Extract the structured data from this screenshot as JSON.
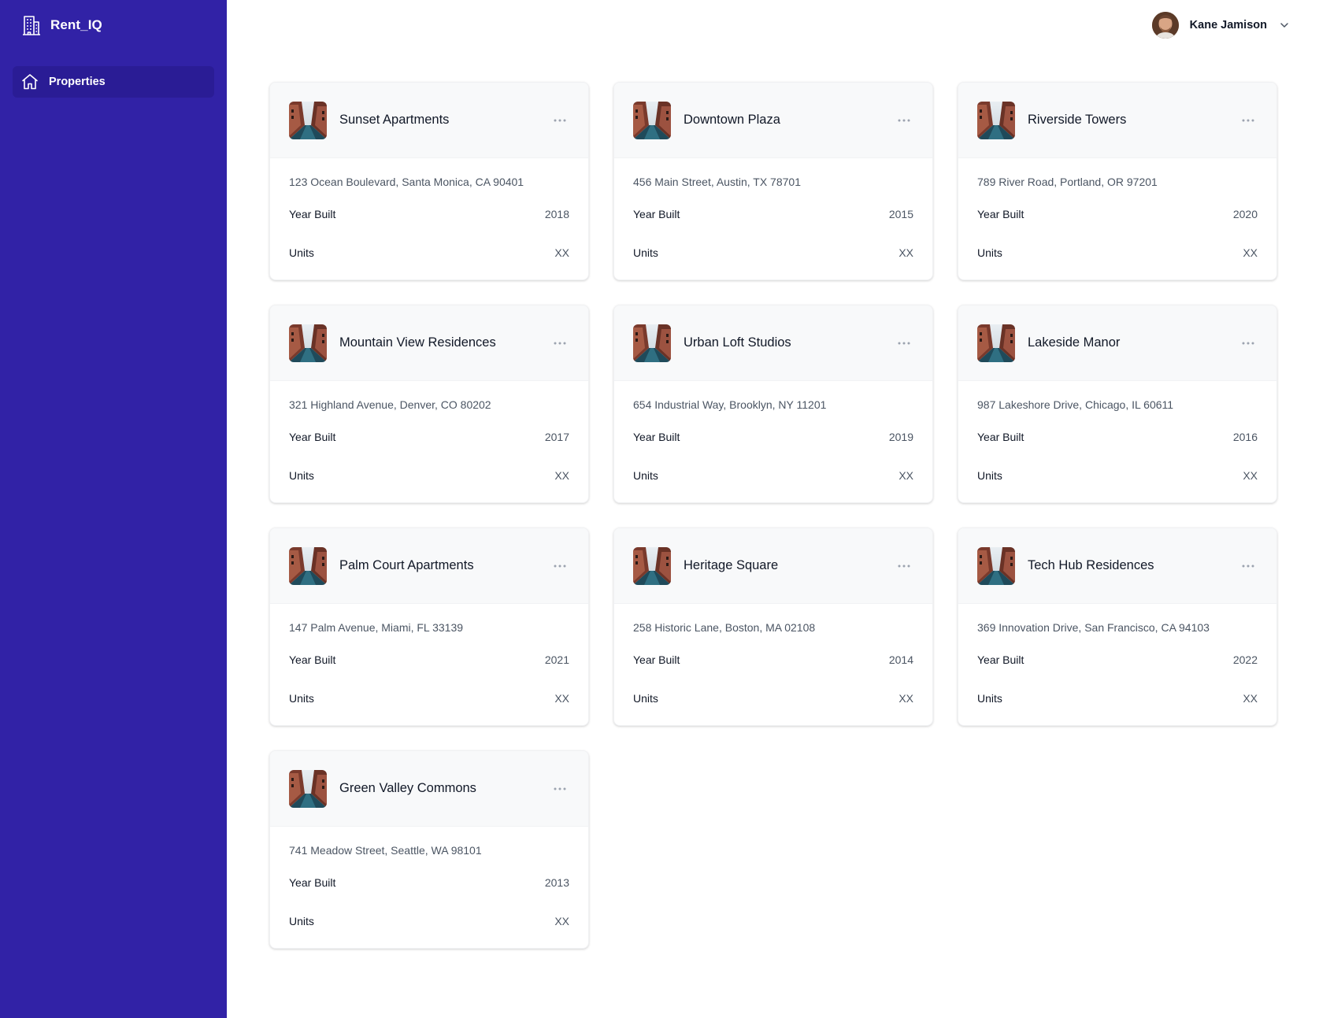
{
  "app": {
    "name": "Rent_IQ"
  },
  "sidebar": {
    "items": [
      {
        "label": "Properties",
        "icon": "home-icon"
      }
    ]
  },
  "user": {
    "name": "Kane Jamison"
  },
  "properties": [
    {
      "name": "Sunset Apartments",
      "address": "123 Ocean Boulevard, Santa Monica, CA 90401",
      "year_label": "Year Built",
      "year": "2018",
      "units_label": "Units",
      "units": "XX"
    },
    {
      "name": "Downtown Plaza",
      "address": "456 Main Street, Austin, TX 78701",
      "year_label": "Year Built",
      "year": "2015",
      "units_label": "Units",
      "units": "XX"
    },
    {
      "name": "Riverside Towers",
      "address": "789 River Road, Portland, OR 97201",
      "year_label": "Year Built",
      "year": "2020",
      "units_label": "Units",
      "units": "XX"
    },
    {
      "name": "Mountain View Residences",
      "address": "321 Highland Avenue, Denver, CO 80202",
      "year_label": "Year Built",
      "year": "2017",
      "units_label": "Units",
      "units": "XX"
    },
    {
      "name": "Urban Loft Studios",
      "address": "654 Industrial Way, Brooklyn, NY 11201",
      "year_label": "Year Built",
      "year": "2019",
      "units_label": "Units",
      "units": "XX"
    },
    {
      "name": "Lakeside Manor",
      "address": "987 Lakeshore Drive, Chicago, IL 60611",
      "year_label": "Year Built",
      "year": "2016",
      "units_label": "Units",
      "units": "XX"
    },
    {
      "name": "Palm Court Apartments",
      "address": "147 Palm Avenue, Miami, FL 33139",
      "year_label": "Year Built",
      "year": "2021",
      "units_label": "Units",
      "units": "XX"
    },
    {
      "name": "Heritage Square",
      "address": "258 Historic Lane, Boston, MA 02108",
      "year_label": "Year Built",
      "year": "2014",
      "units_label": "Units",
      "units": "XX"
    },
    {
      "name": "Tech Hub Residences",
      "address": "369 Innovation Drive, San Francisco, CA 94103",
      "year_label": "Year Built",
      "year": "2022",
      "units_label": "Units",
      "units": "XX"
    },
    {
      "name": "Green Valley Commons",
      "address": "741 Meadow Street, Seattle, WA 98101",
      "year_label": "Year Built",
      "year": "2013",
      "units_label": "Units",
      "units": "XX"
    }
  ],
  "colors": {
    "sidebar": "#3122a6",
    "nav_active": "#2a1c95",
    "card_header": "#f8f9fa"
  }
}
